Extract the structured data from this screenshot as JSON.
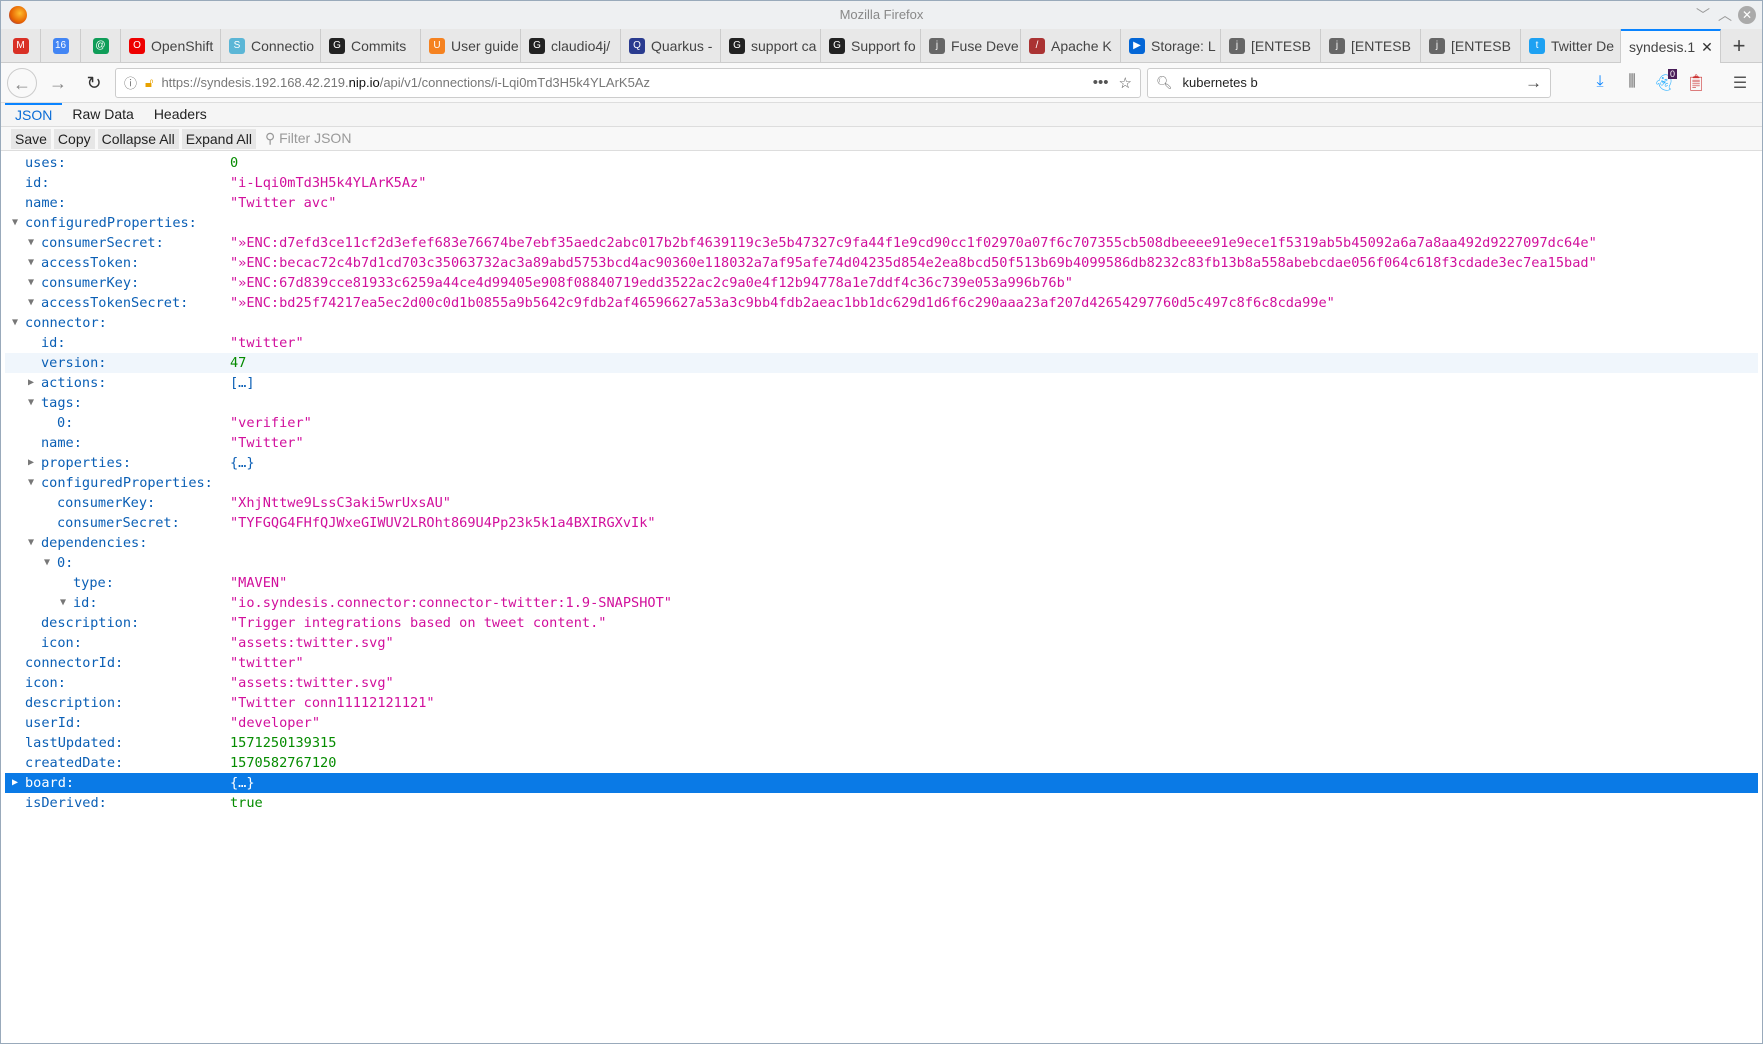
{
  "window": {
    "title": "Mozilla Firefox"
  },
  "tabs": [
    {
      "label": "",
      "icon": "gmail-icon",
      "color": "#d93025",
      "glyph": "M"
    },
    {
      "label": "",
      "icon": "calendar-icon",
      "color": "#4285f4",
      "glyph": "16"
    },
    {
      "label": "",
      "icon": "hangouts-icon",
      "color": "#0f9d58",
      "glyph": "@"
    },
    {
      "label": "OpenShift",
      "icon": "openshift-icon",
      "color": "#e00",
      "glyph": "O"
    },
    {
      "label": "Connectio",
      "icon": "syndesis-icon",
      "color": "#5bb6d6",
      "glyph": "S"
    },
    {
      "label": "Commits",
      "icon": "github-icon",
      "color": "#222",
      "glyph": "G"
    },
    {
      "label": "User guide",
      "icon": "userguide-icon",
      "color": "#f58220",
      "glyph": "U"
    },
    {
      "label": "claudio4j/",
      "icon": "github-icon",
      "color": "#222",
      "glyph": "G"
    },
    {
      "label": "Quarkus -",
      "icon": "quarkus-icon",
      "color": "#2a3b8f",
      "glyph": "Q"
    },
    {
      "label": "support ca",
      "icon": "github-icon",
      "color": "#222",
      "glyph": "G"
    },
    {
      "label": "Support fo",
      "icon": "github-icon",
      "color": "#222",
      "glyph": "G"
    },
    {
      "label": "Fuse Deve",
      "icon": "jboss-icon",
      "color": "#666",
      "glyph": "j"
    },
    {
      "label": "Apache K",
      "icon": "apache-feather-icon",
      "color": "#a33",
      "glyph": "/"
    },
    {
      "label": "Storage: L",
      "icon": "storage-icon",
      "color": "#0366d6",
      "glyph": "▶"
    },
    {
      "label": "[ENTESB",
      "icon": "jboss-icon",
      "color": "#666",
      "glyph": "j"
    },
    {
      "label": "[ENTESB",
      "icon": "jboss-icon",
      "color": "#666",
      "glyph": "j"
    },
    {
      "label": "[ENTESB",
      "icon": "jboss-icon",
      "color": "#666",
      "glyph": "j"
    },
    {
      "label": "Twitter De",
      "icon": "twitter-icon",
      "color": "#1da1f2",
      "glyph": "t"
    },
    {
      "label": "syndesis.1",
      "icon": "",
      "color": "",
      "glyph": "",
      "active": true
    }
  ],
  "nav": {
    "url_prefix": "https://syndesis.192.168.42.219.",
    "url_host": "nip.io",
    "url_path": "/api/v1/connections/i-Lqi0mTd3H5k4YLArK5Az",
    "search_value": "kubernetes b",
    "badge_count": "0"
  },
  "viewer": {
    "tabs": [
      "JSON",
      "Raw Data",
      "Headers"
    ],
    "toolbar": {
      "save": "Save",
      "copy": "Copy",
      "collapse_all": "Collapse All",
      "expand_all": "Expand All",
      "filter_placeholder": "Filter JSON"
    }
  },
  "rows": [
    {
      "key": "uses:",
      "value": "0",
      "type": "number",
      "depth": 0,
      "toggle": ""
    },
    {
      "key": "id:",
      "value": "\"i-Lqi0mTd3H5k4YLArK5Az\"",
      "type": "string",
      "depth": 0,
      "toggle": ""
    },
    {
      "key": "name:",
      "value": "\"Twitter avc\"",
      "type": "string",
      "depth": 0,
      "toggle": ""
    },
    {
      "key": "configuredProperties:",
      "value": "",
      "type": "",
      "depth": 0,
      "toggle": "open"
    },
    {
      "key": "consumerSecret:",
      "value": "\"»ENC:d7efd3ce11cf2d3efef683e76674be7ebf35aedc2abc017b2bf4639119c3e5b47327c9fa44f1e9cd90cc1f02970a07f6c707355cb508dbeeee91e9ece1f5319ab5b45092a6a7a8aa492d9227097dc64e\"",
      "type": "string",
      "depth": 1,
      "toggle": "open"
    },
    {
      "key": "accessToken:",
      "value": "\"»ENC:becac72c4b7d1cd703c35063732ac3a89abd5753bcd4ac90360e118032a7af95afe74d04235d854e2ea8bcd50f513b69b4099586db8232c83fb13b8a558abebcdae056f064c618f3cdade3ec7ea15bad\"",
      "type": "string",
      "depth": 1,
      "toggle": "open"
    },
    {
      "key": "consumerKey:",
      "value": "\"»ENC:67d839cce81933c6259a44ce4d99405e908f08840719edd3522ac2c9a0e4f12b94778a1e7ddf4c36c739e053a996b76b\"",
      "type": "string",
      "depth": 1,
      "toggle": "open"
    },
    {
      "key": "accessTokenSecret:",
      "value": "\"»ENC:bd25f74217ea5ec2d00c0d1b0855a9b5642c9fdb2af46596627a53a3c9bb4fdb2aeac1bb1dc629d1d6f6c290aaa23af207d42654297760d5c497c8f6c8cda99e\"",
      "type": "string",
      "depth": 1,
      "toggle": "open"
    },
    {
      "key": "connector:",
      "value": "",
      "type": "",
      "depth": 0,
      "toggle": "open"
    },
    {
      "key": "id:",
      "value": "\"twitter\"",
      "type": "string",
      "depth": 1,
      "toggle": ""
    },
    {
      "key": "version:",
      "value": "47",
      "type": "number",
      "depth": 1,
      "toggle": "",
      "hover": true
    },
    {
      "key": "actions:",
      "value": "[…]",
      "type": "collapsed",
      "depth": 1,
      "toggle": "closed"
    },
    {
      "key": "tags:",
      "value": "",
      "type": "",
      "depth": 1,
      "toggle": "open"
    },
    {
      "key": "0:",
      "value": "\"verifier\"",
      "type": "string",
      "depth": 2,
      "toggle": ""
    },
    {
      "key": "name:",
      "value": "\"Twitter\"",
      "type": "string",
      "depth": 1,
      "toggle": ""
    },
    {
      "key": "properties:",
      "value": "{…}",
      "type": "collapsed",
      "depth": 1,
      "toggle": "closed"
    },
    {
      "key": "configuredProperties:",
      "value": "",
      "type": "",
      "depth": 1,
      "toggle": "open"
    },
    {
      "key": "consumerKey:",
      "value": "\"XhjNttwe9LssC3aki5wrUxsAU\"",
      "type": "string",
      "depth": 2,
      "toggle": ""
    },
    {
      "key": "consumerSecret:",
      "value": "\"TYFGQG4FHfQJWxeGIWUV2LROht869U4Pp23k5k1a4BXIRGXvIk\"",
      "type": "string",
      "depth": 2,
      "toggle": ""
    },
    {
      "key": "dependencies:",
      "value": "",
      "type": "",
      "depth": 1,
      "toggle": "open"
    },
    {
      "key": "0:",
      "value": "",
      "type": "",
      "depth": 2,
      "toggle": "open"
    },
    {
      "key": "type:",
      "value": "\"MAVEN\"",
      "type": "string",
      "depth": 3,
      "toggle": ""
    },
    {
      "key": "id:",
      "value": "\"io.syndesis.connector:connector-twitter:1.9-SNAPSHOT\"",
      "type": "string",
      "depth": 3,
      "toggle": "open"
    },
    {
      "key": "description:",
      "value": "\"Trigger integrations based on tweet content.\"",
      "type": "string",
      "depth": 1,
      "toggle": ""
    },
    {
      "key": "icon:",
      "value": "\"assets:twitter.svg\"",
      "type": "string",
      "depth": 1,
      "toggle": ""
    },
    {
      "key": "connectorId:",
      "value": "\"twitter\"",
      "type": "string",
      "depth": 0,
      "toggle": ""
    },
    {
      "key": "icon:",
      "value": "\"assets:twitter.svg\"",
      "type": "string",
      "depth": 0,
      "toggle": ""
    },
    {
      "key": "description:",
      "value": "\"Twitter conn11112121121\"",
      "type": "string",
      "depth": 0,
      "toggle": ""
    },
    {
      "key": "userId:",
      "value": "\"developer\"",
      "type": "string",
      "depth": 0,
      "toggle": ""
    },
    {
      "key": "lastUpdated:",
      "value": "1571250139315",
      "type": "number",
      "depth": 0,
      "toggle": ""
    },
    {
      "key": "createdDate:",
      "value": "1570582767120",
      "type": "number",
      "depth": 0,
      "toggle": ""
    },
    {
      "key": "board:",
      "value": "{…}",
      "type": "collapsed",
      "depth": 0,
      "toggle": "closed",
      "selected": true
    },
    {
      "key": "isDerived:",
      "value": "true",
      "type": "boolean",
      "depth": 0,
      "toggle": ""
    }
  ]
}
